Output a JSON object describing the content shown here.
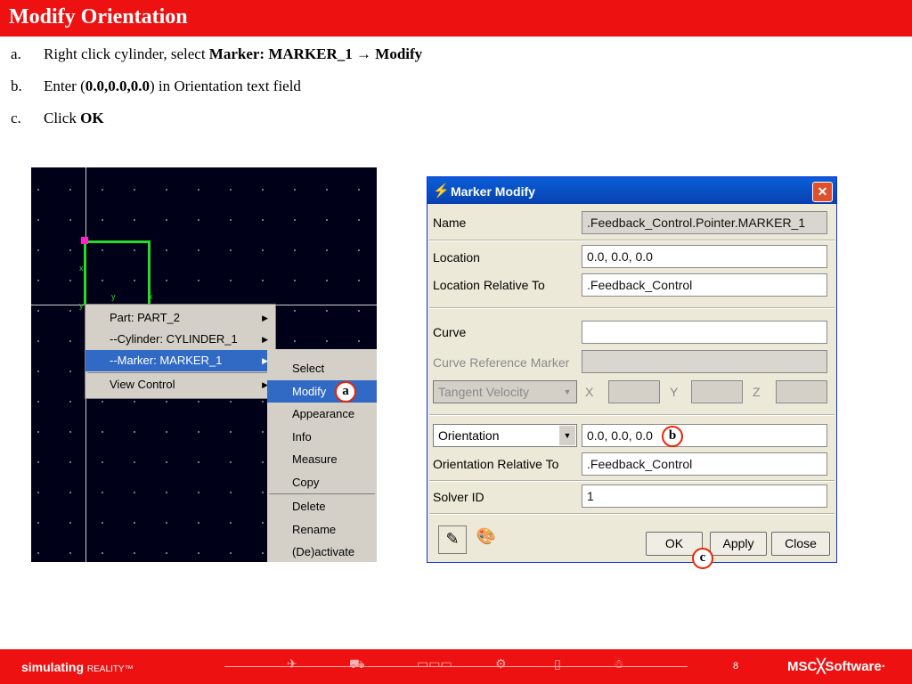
{
  "title": "Modify Orientation",
  "steps": [
    {
      "letter": "a.",
      "prefix": "Right click cylinder, select ",
      "bold": "Marker: MARKER_1 → Modify",
      "suffix": ""
    },
    {
      "letter": "b.",
      "prefix": "Enter (",
      "bold": "0.0,0.0,0.0",
      "suffix": ") in Orientation text field"
    },
    {
      "letter": "c.",
      "prefix": "Click ",
      "bold": "OK",
      "suffix": ""
    }
  ],
  "viewport": {
    "axis_labels": {
      "x1": "x",
      "y1": "y",
      "y2": "y",
      "x2": "x"
    },
    "context_menu": [
      {
        "label": "Part: PART_2",
        "has_submenu": true
      },
      {
        "label": "--Cylinder: CYLINDER_1",
        "has_submenu": true
      },
      {
        "label": "--Marker: MARKER_1",
        "has_submenu": true,
        "selected": true
      },
      {
        "label": "View Control",
        "has_submenu": true
      }
    ],
    "submenu": [
      "Select",
      "Modify",
      "Appearance",
      "Info",
      "Measure",
      "Copy",
      "Delete",
      "Rename",
      "(De)activate"
    ],
    "submenu_selected": "Modify"
  },
  "dialog": {
    "title": "Marker Modify",
    "close_glyph": "✕",
    "rows": {
      "name_label": "Name",
      "name_value": ".Feedback_Control.Pointer.MARKER_1",
      "location_label": "Location",
      "location_value": "0.0, 0.0, 0.0",
      "loc_rel_label": "Location Relative To",
      "loc_rel_value": ".Feedback_Control",
      "curve_label": "Curve",
      "curve_value": "",
      "curve_ref_label": "Curve Reference Marker",
      "curve_ref_value": "",
      "tangent_value": "Tangent Velocity",
      "x_label": "X",
      "y_label": "Y",
      "z_label": "Z",
      "orientation_select": "Orientation",
      "orientation_value": "0.0, 0.0, 0.0",
      "orient_rel_label": "Orientation Relative To",
      "orient_rel_value": ".Feedback_Control",
      "solver_label": "Solver ID",
      "solver_value": "1"
    },
    "buttons": {
      "ok": "OK",
      "apply": "Apply",
      "close": "Close"
    }
  },
  "callouts": {
    "a": "a",
    "b": "b",
    "c": "c"
  },
  "footer": {
    "brand_bold": "simulating",
    "brand_rest": "REALITY™",
    "page_number": "8",
    "logo": "MSC╳Software·"
  },
  "colors": {
    "accent_red": "#ee1111",
    "selection_blue": "#316ac5",
    "viewport_bg": "#000018",
    "geometry_green": "#22dd22"
  }
}
